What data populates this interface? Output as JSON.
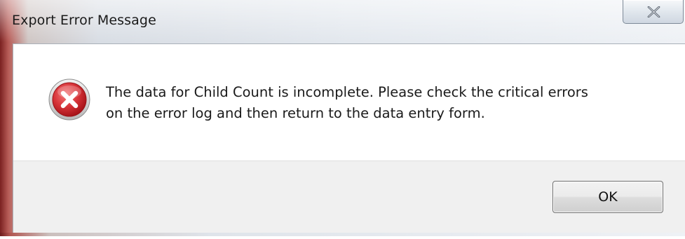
{
  "window": {
    "title": "Export Error Message",
    "close_icon": "close-x-icon"
  },
  "dialog": {
    "icon": "error-icon",
    "message_lines": [
      "The data for Child Count is incomplete.  Please check the critical errors",
      "on the error log and then return to the data entry form."
    ]
  },
  "buttons": {
    "ok_label": "OK"
  },
  "colors": {
    "error_red": "#d8353a",
    "frame_accent": "#b75c57",
    "footer_bg": "#f0f0f0"
  }
}
